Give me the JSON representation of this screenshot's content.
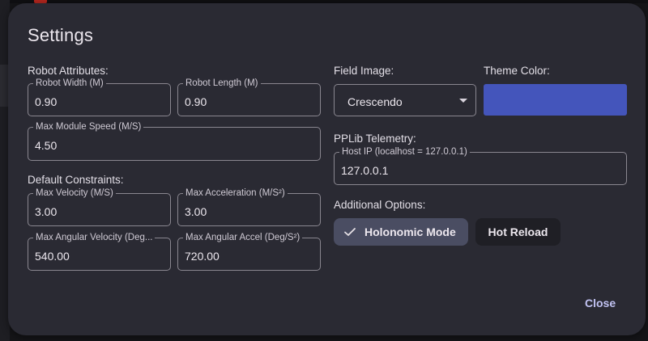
{
  "dialog": {
    "title": "Settings",
    "close_label": "Close"
  },
  "robot": {
    "section_label": "Robot Attributes:",
    "width_label": "Robot Width (M)",
    "width_value": "0.90",
    "length_label": "Robot Length (M)",
    "length_value": "0.90",
    "max_module_speed_label": "Max Module Speed (M/S)",
    "max_module_speed_value": "4.50"
  },
  "constraints": {
    "section_label": "Default Constraints:",
    "max_velocity_label": "Max Velocity (M/S)",
    "max_velocity_value": "3.00",
    "max_acceleration_label": "Max Acceleration (M/S²)",
    "max_acceleration_value": "3.00",
    "max_angular_velocity_label": "Max Angular Velocity (Deg...",
    "max_angular_velocity_value": "540.00",
    "max_angular_accel_label": "Max Angular Accel (Deg/S²)",
    "max_angular_accel_value": "720.00"
  },
  "field_image": {
    "label": "Field Image:",
    "selected": "Crescendo"
  },
  "theme": {
    "label": "Theme Color:",
    "color": "#4455bb"
  },
  "telemetry": {
    "section_label": "PPLib Telemetry:",
    "host_ip_label": "Host IP (localhost = 127.0.0.1)",
    "host_ip_value": "127.0.0.1"
  },
  "options": {
    "section_label": "Additional Options:",
    "holonomic_label": "Holonomic Mode",
    "holonomic_selected": true,
    "hot_reload_label": "Hot Reload"
  },
  "icons": {
    "holonomic_check": "check-icon",
    "field_dropdown": "chevron-down-icon"
  }
}
